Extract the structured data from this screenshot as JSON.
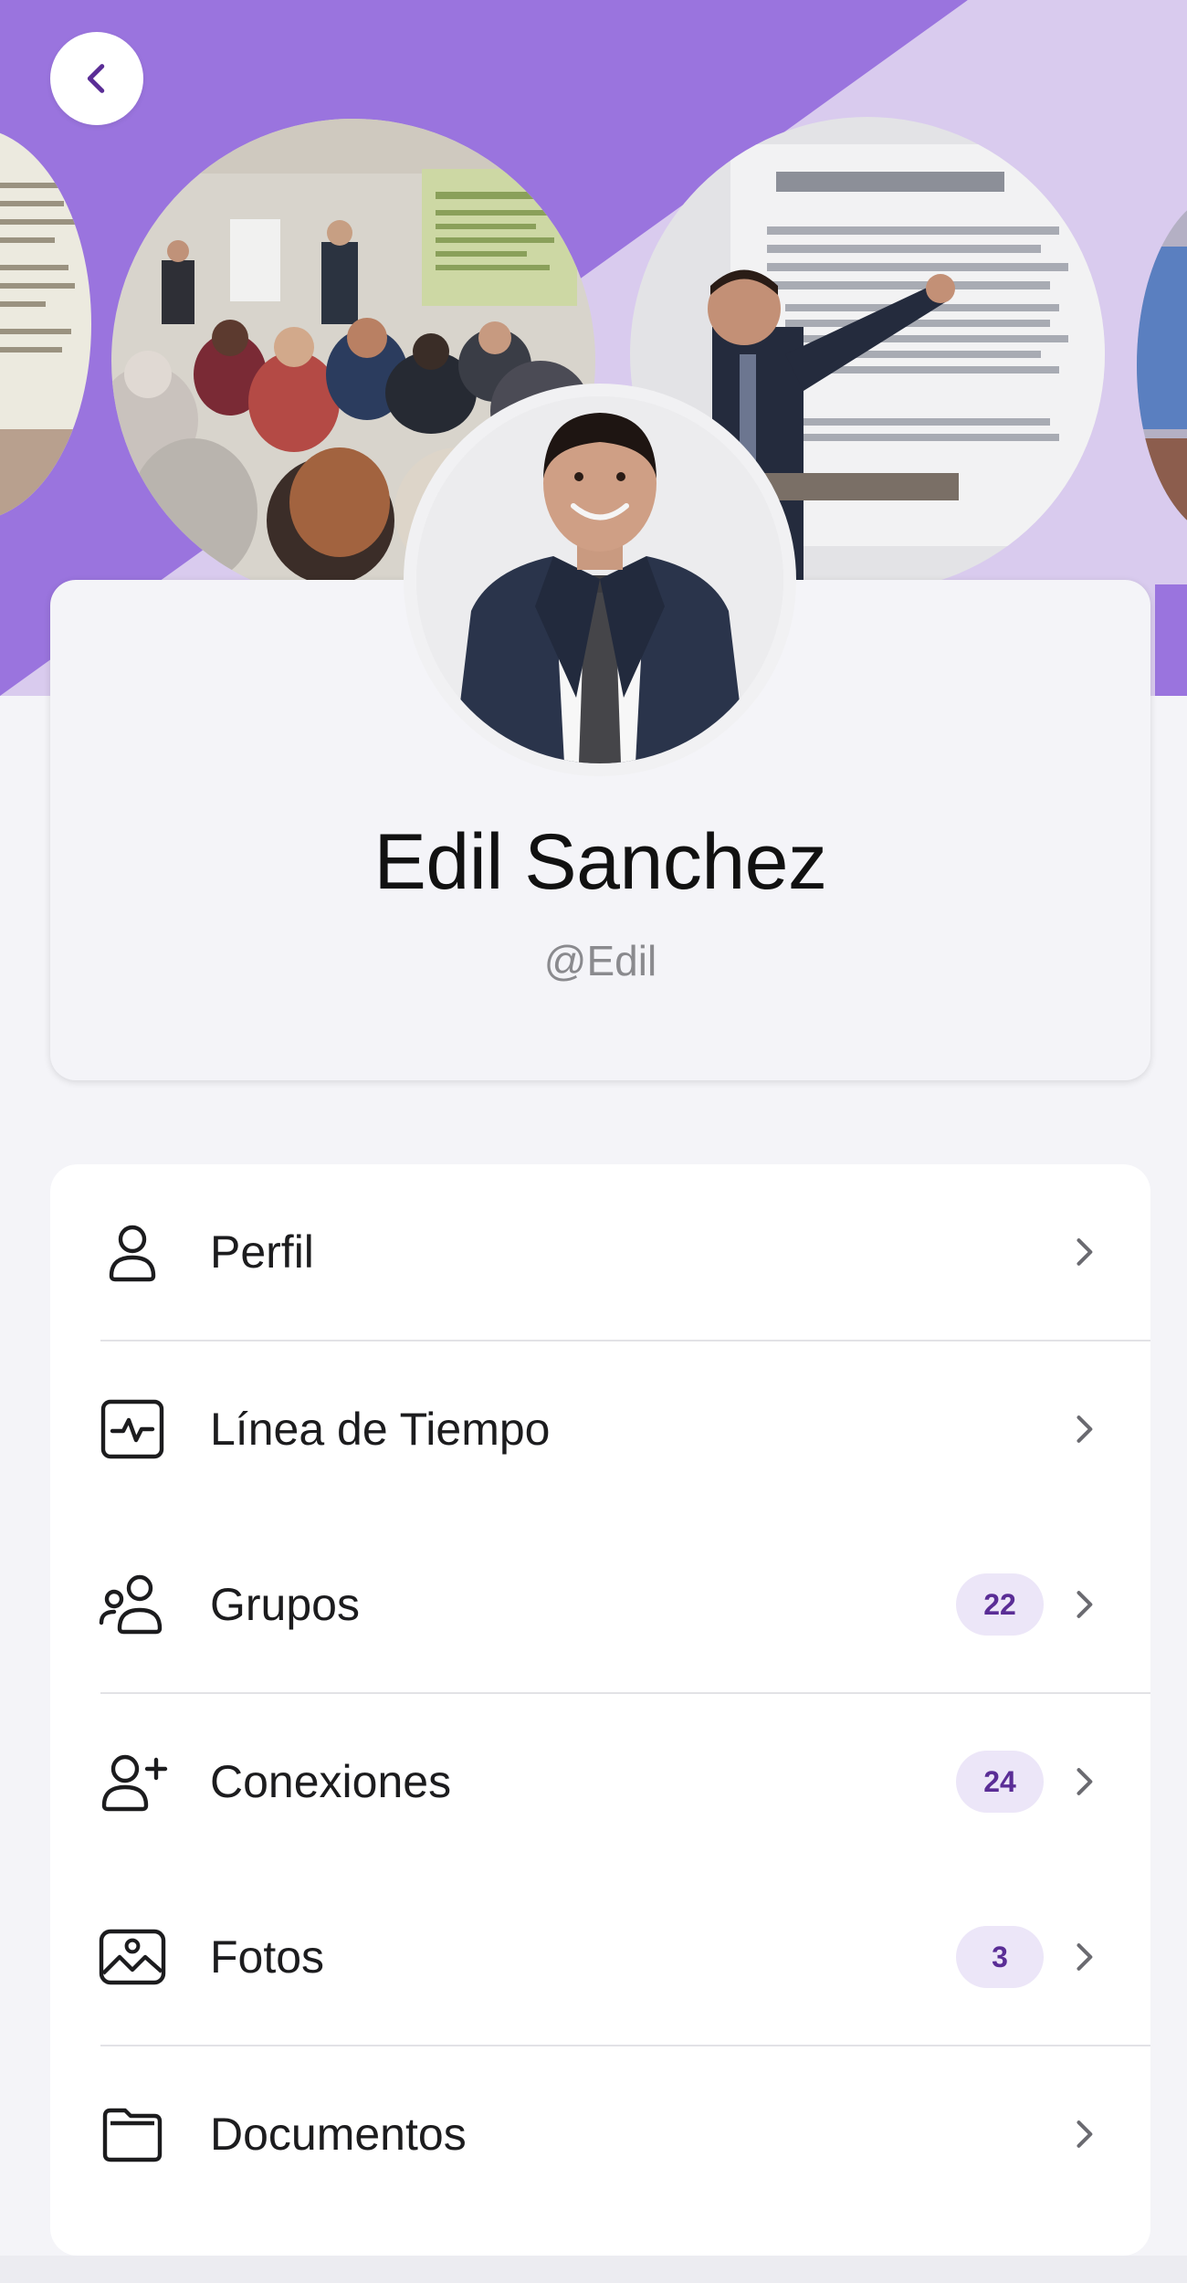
{
  "colors": {
    "cover_purple": "#9a74de",
    "cover_lavender": "#d9cbee",
    "badge_bg": "#ece6f8",
    "badge_text": "#5a2d96",
    "background": "#f4f4f8"
  },
  "header": {
    "back_icon": "chevron-left-icon"
  },
  "profile": {
    "name": "Edil Sanchez",
    "handle": "@Edil"
  },
  "menu": {
    "items": [
      {
        "label": "Perfil",
        "icon": "user-icon",
        "badge": ""
      },
      {
        "label": "Línea de Tiempo",
        "icon": "activity-icon",
        "badge": ""
      },
      {
        "label": "Grupos",
        "icon": "users-icon",
        "badge": "22"
      },
      {
        "label": "Conexiones",
        "icon": "user-plus-icon",
        "badge": "24"
      },
      {
        "label": "Fotos",
        "icon": "image-icon",
        "badge": "3"
      },
      {
        "label": "Documentos",
        "icon": "folder-icon",
        "badge": ""
      }
    ]
  }
}
